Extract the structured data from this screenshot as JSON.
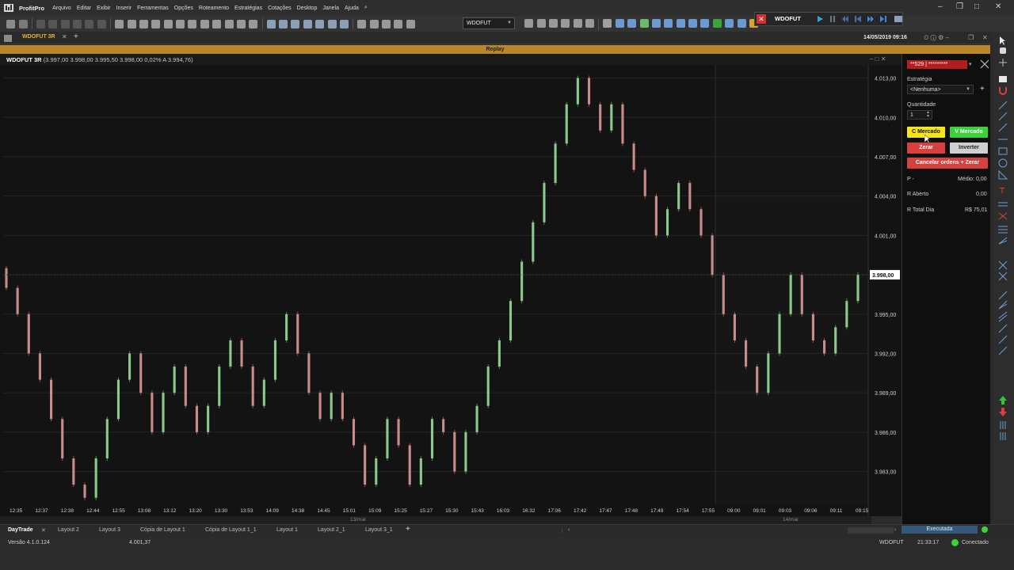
{
  "app": {
    "name": "ProfitPro",
    "menu": [
      "Arquivo",
      "Editar",
      "Exibir",
      "Inserir",
      "Ferramentas",
      "Opções",
      "Roteamento",
      "Estratégias",
      "Cotações",
      "Desktop",
      "Janela",
      "Ajuda"
    ],
    "symbol_selector": "WDOFUT"
  },
  "replay": {
    "symbol": "WDOFUT",
    "banner": "Replay",
    "datetime": "14/05/2019 09:16"
  },
  "chart": {
    "tab_label": "WDOFUT 3R",
    "header_symbol": "WDOFUT 3R",
    "header_values": "(3.997,00  3.998,00  3.995,50  3.998,00  0,02%  A 3.994,76)",
    "current_price": "3.998,00",
    "day_labels": [
      "13/mai",
      "14/mai"
    ]
  },
  "chart_data": {
    "type": "renko",
    "brick_size": 3,
    "ylim": [
      3980.5,
      4014
    ],
    "y_ticks": [
      4013,
      4010,
      4007,
      4004,
      4001,
      3998,
      3995,
      3992,
      3989,
      3986,
      3983
    ],
    "y_tick_labels": [
      "4.013,00",
      "4.010,00",
      "4.007,00",
      "4.004,00",
      "4.001,00",
      "3.998,00",
      "3.995,00",
      "3.992,00",
      "3.989,00",
      "3.986,00",
      "3.983,00"
    ],
    "x_labels": [
      "12:35",
      "12:37",
      "12:38",
      "12:44",
      "12:55",
      "13:08",
      "13:12",
      "13:20",
      "13:30",
      "13:53",
      "14:09",
      "14:38",
      "14:45",
      "15:01",
      "15:09",
      "15:25",
      "15:27",
      "15:30",
      "15:43",
      "16:03",
      "16:32",
      "17:06",
      "17:42",
      "17:47",
      "17:48",
      "17:49",
      "17:54",
      "17:55",
      "09:00",
      "09:01",
      "09:03",
      "09:06",
      "09:11",
      "09:15"
    ],
    "close_series": [
      3997,
      3995,
      3992,
      3990,
      3987,
      3984,
      3982,
      3981,
      3984,
      3987,
      3990,
      3992,
      3989,
      3986,
      3989,
      3991,
      3988,
      3986,
      3988,
      3991,
      3993,
      3991,
      3988,
      3990,
      3993,
      3995,
      3992,
      3989,
      3987,
      3989,
      3987,
      3985,
      3982,
      3984,
      3987,
      3985,
      3982,
      3984,
      3987,
      3986,
      3983,
      3986,
      3988,
      3991,
      3993,
      3996,
      3999,
      4002,
      4005,
      4008,
      4011,
      4013,
      4011,
      4009,
      4011,
      4008,
      4006,
      4004,
      4001,
      4003,
      4005,
      4003,
      4001,
      3998,
      3995,
      3993,
      3991,
      3989,
      3992,
      3995,
      3998,
      3995,
      3993,
      3992,
      3994,
      3996,
      3998
    ],
    "up_color": "#8cc98c",
    "down_color": "#c98c8c"
  },
  "trade_panel": {
    "account": "**529 | *********",
    "strategy_label": "Estratégia",
    "strategy_value": "<Nenhuma>",
    "qty_label": "Quantidade",
    "qty_value": "1",
    "buy_market": "C Mercado",
    "sell_market": "V Mercado",
    "zero": "Zerar",
    "invert": "Inverter",
    "cancel_zero": "Cancelar ordens + Zerar",
    "p_label": "P  -",
    "avg_label": "Médio: 0,00",
    "open_label": "R Aberto",
    "open_value": "0,00",
    "total_label": "R Total Dia",
    "total_value": "R$ 75,01"
  },
  "layouts": {
    "tabs": [
      "DayTrade",
      "Layout 2",
      "Layout 3",
      "Cópia de Layout 1",
      "Cópia de Layout 1_1",
      "Layout 1",
      "Layout 2_1",
      "Layout 3_1"
    ],
    "add": "+"
  },
  "status": {
    "version": "Versão 4.1.0.124",
    "cursor_price": "4.001,37",
    "symbol": "WDOFUT",
    "time": "21:33:17",
    "connection": "Conectado",
    "executed": "Executada"
  },
  "colors": {
    "banner": "#b8862b",
    "buy": "#f5e61c",
    "sell": "#3ad13a",
    "zero": "#d84040",
    "cancel": "#d84040",
    "chart_bg": "#131313"
  }
}
